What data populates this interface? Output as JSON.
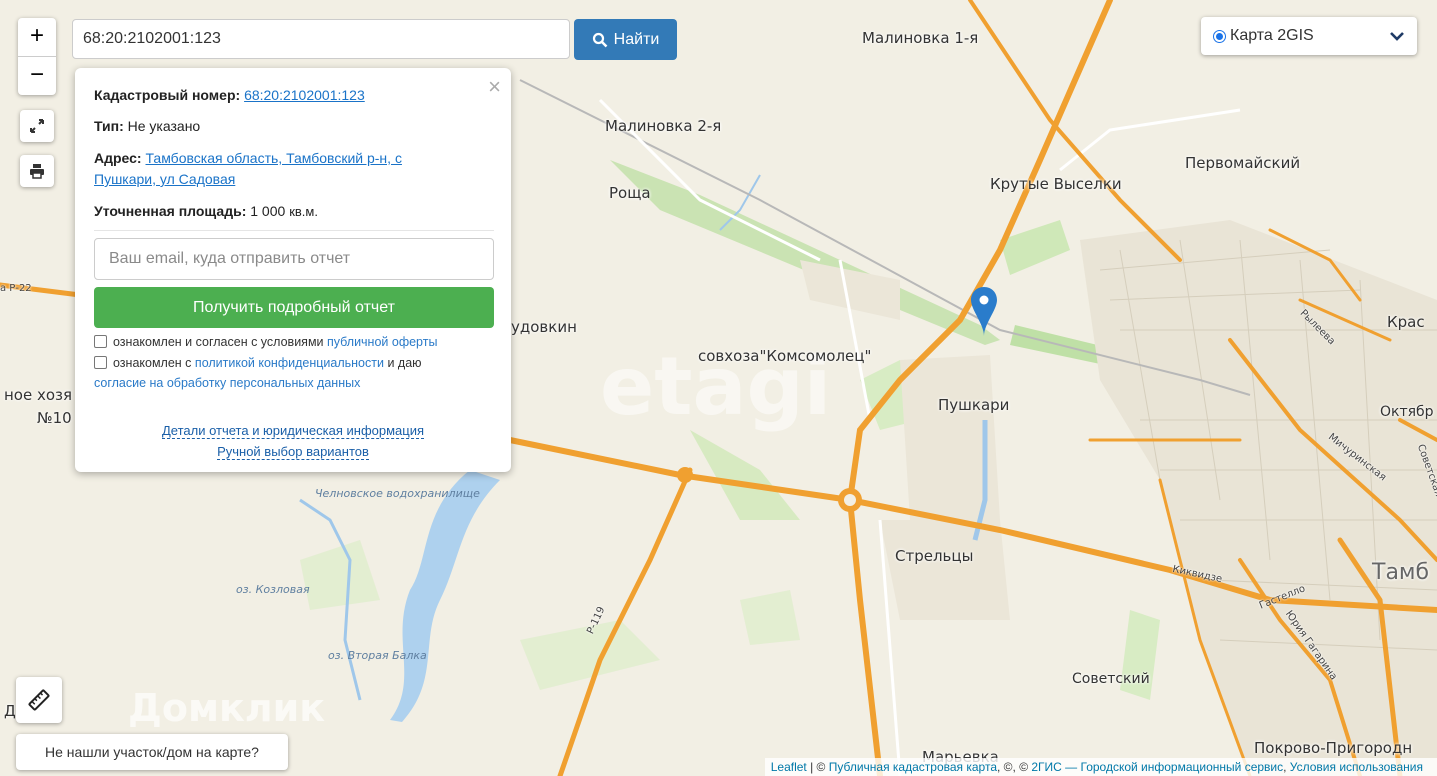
{
  "search": {
    "value": "68:20:2102001:123",
    "button": "Найти"
  },
  "zoom": {
    "in": "+",
    "out": "−"
  },
  "layer_selector": {
    "selected": "Карта 2GIS"
  },
  "popup": {
    "cadastral_label": "Кадастровый номер:",
    "cadastral_value": "68:20:2102001:123",
    "type_label": "Тип:",
    "type_value": "Не указано",
    "address_label": "Адрес:",
    "address_line1": "Тамбовская область, Тамбовский р-н, с",
    "address_line2": "Пушкари, ул Садовая",
    "area_label": "Уточненная площадь:",
    "area_value": "1 000",
    "area_unit": "кв.м.",
    "email_placeholder": "Ваш email, куда отправить отчет",
    "report_button": "Получить подробный отчет",
    "consent1_text": "ознакомлен и согласен с условиями",
    "consent1_link": "публичной оферты",
    "consent2_text_a": "ознакомлен с",
    "consent2_link1": "политикой конфиденциальности",
    "consent2_text_b": "и даю",
    "consent2_link2": "согласие на обработку персональных данных",
    "details_link": "Детали отчета и юридическая информация",
    "manual_link": "Ручной выбор вариантов"
  },
  "map": {
    "places": {
      "malinovka1": "Малиновка 1-я",
      "malinovka2": "Малиновка 2-я",
      "roshcha": "Роща",
      "krutye": "Крутые Выселки",
      "pervomaisky": "Первомайский",
      "komsomolets": "совхоза\"Комсомолец\"",
      "pushkari": "Пушкари",
      "streltsy": "Стрельцы",
      "sovetsky": "Советский",
      "marevka": "Марьевка",
      "pokrovo": "Покрово-Пригородн",
      "oktyabr": "Октябр",
      "krasn": "Крас",
      "tambov": "Тамб",
      "udovkin": "удовкин",
      "khozya": "ное хозя",
      "no10": "№10",
      "d_letter": "Д"
    },
    "water": {
      "chelnovskoe": "Челновское водохранилище",
      "kozlovaya": "оз. Козловая",
      "vtoraya": "оз. Вторая Балка"
    },
    "roads": {
      "r22": "а Р-22",
      "r119": "Р-119",
      "ryleeva": "Рылеева",
      "michurinskaya": "Мичуринская",
      "sovetskaya": "Советская",
      "kikvidze": "Киквидзе",
      "gastello": "Гастелло",
      "gagarina": "Юрия Гагарина"
    },
    "watermarks": {
      "etagi": "etagi",
      "domclick": "Домклик"
    }
  },
  "not_found_button": "Не нашли участок/дом на карте?",
  "attribution": {
    "leaflet": "Leaflet",
    "sep1": " | © ",
    "pkk": "Публичная кадастровая карта",
    "sep2": ", ©, © ",
    "gis": "2ГИС — Городской информационный сервис",
    "sep3": ", ",
    "terms": "Условия использования"
  },
  "colors": {
    "primary": "#337ab7",
    "success": "#4caf50",
    "marker": "#2a7ccb",
    "road": "#f0a030"
  }
}
